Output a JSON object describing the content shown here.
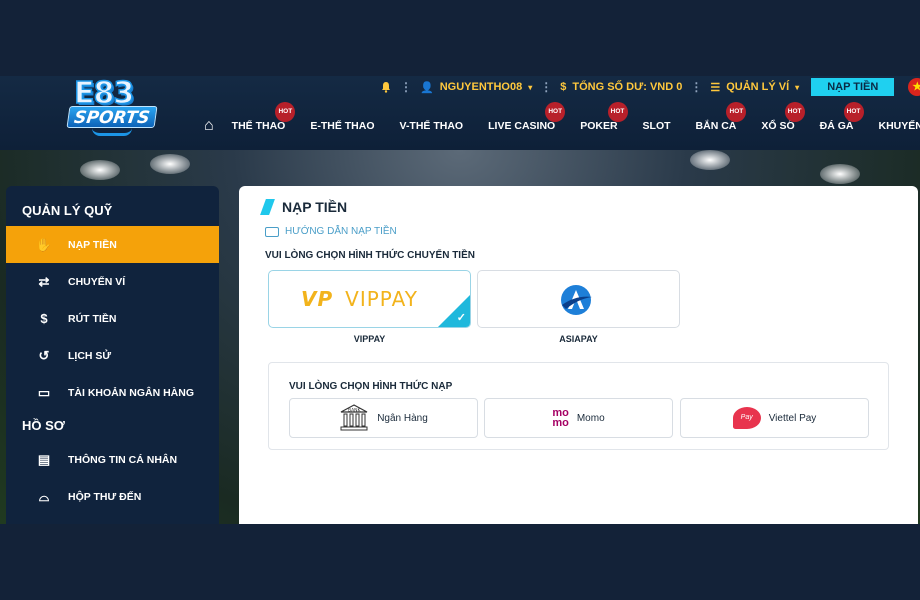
{
  "logo": {
    "top": "E83",
    "bottom": "SPORTS"
  },
  "topbar": {
    "username": "NGUYENTHO08",
    "balance_label": "TỔNG SỐ DƯ: VND 0",
    "wallet_label": "QUẢN LÝ VÍ",
    "deposit_button": "NẠP TIỀN",
    "flag_symbol": "★"
  },
  "nav": {
    "home_icon": "home-icon",
    "hot_label": "HOT",
    "items": [
      {
        "label": "THỂ THAO"
      },
      {
        "label": "E-THỂ THAO"
      },
      {
        "label": "V-THỂ THAO"
      },
      {
        "label": "LIVE CASINO"
      },
      {
        "label": "POKER"
      },
      {
        "label": "SLOT"
      },
      {
        "label": "BẮN CÁ"
      },
      {
        "label": "XỔ SỐ"
      },
      {
        "label": "ĐÁ GÀ"
      },
      {
        "label": "KHUYẾN MÃI"
      }
    ]
  },
  "sidebar": {
    "fund_title": "QUẢN LÝ QUỸ",
    "fund_items": [
      {
        "label": "NẠP TIỀN",
        "icon": "hand-coin-icon"
      },
      {
        "label": "CHUYỂN VÍ",
        "icon": "transfer-icon"
      },
      {
        "label": "RÚT TIỀN",
        "icon": "dollar-icon"
      },
      {
        "label": "LỊCH SỬ",
        "icon": "history-icon"
      },
      {
        "label": "TÀI KHOẢN NGÂN HÀNG",
        "icon": "bank-card-icon"
      }
    ],
    "profile_title": "HỒ SƠ",
    "profile_items": [
      {
        "label": "THÔNG TIN CÁ NHÂN",
        "icon": "id-card-icon"
      },
      {
        "label": "HỘP THƯ ĐẾN",
        "icon": "inbox-icon"
      }
    ]
  },
  "main": {
    "title": "NẠP TIỀN",
    "guide_link": "HƯỚNG DẪN NẠP TIỀN",
    "transfer_label": "VUI LÒNG CHỌN HÌNH THỨC CHUYỂN TIỀN",
    "transfer_methods": [
      {
        "name": "VIPPAY",
        "logo_text": "VIPPAY",
        "logo_mark": "VP",
        "selected": true
      },
      {
        "name": "ASIAPAY",
        "selected": false
      }
    ],
    "deposit_label": "VUI LÒNG CHỌN HÌNH THỨC NẠP",
    "deposit_methods": [
      {
        "name": "Ngân Hàng",
        "icon": "bank-building-icon",
        "icon_text": "BANK"
      },
      {
        "name": "Momo",
        "icon": "momo-icon",
        "icon_text_top": "mo",
        "icon_text_bottom": "mo"
      },
      {
        "name": "Viettel Pay",
        "icon": "viettel-pay-icon",
        "icon_text": "Pay"
      }
    ]
  },
  "colors": {
    "accent_orange": "#f5a20a",
    "accent_cyan": "#1fd0f0",
    "gold": "#ffc83d",
    "hot_red": "#b8202a"
  }
}
